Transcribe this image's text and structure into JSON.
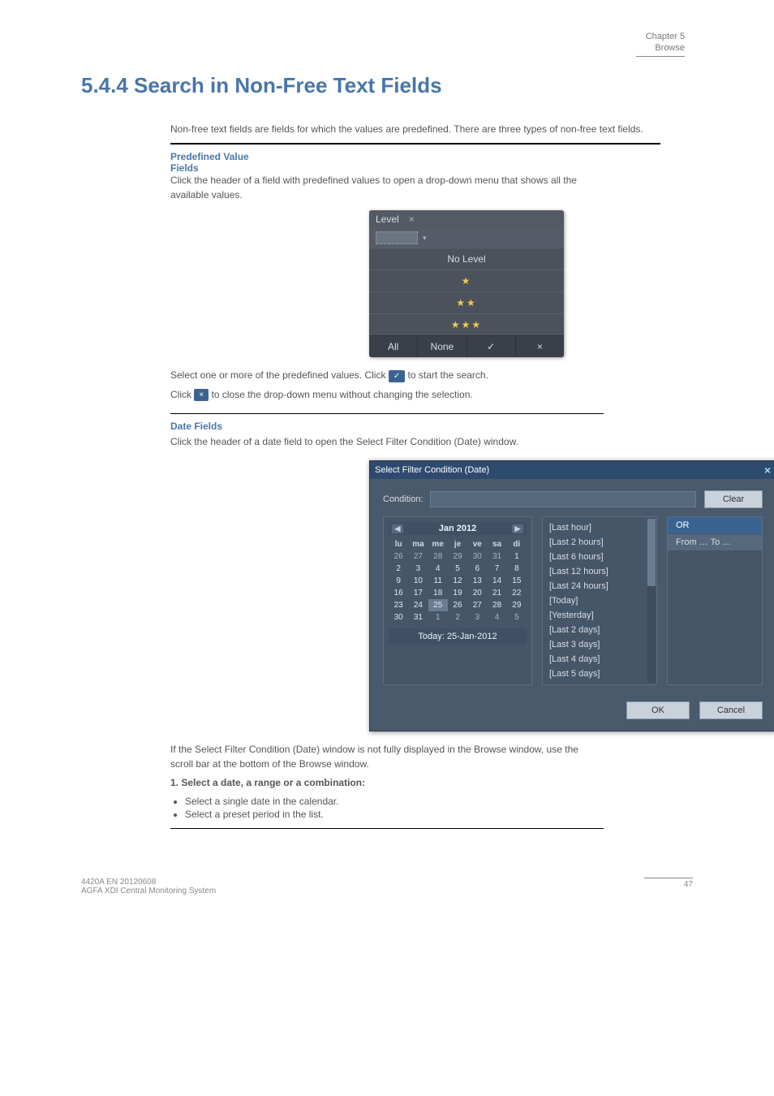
{
  "header": {
    "chapter": "Chapter 5",
    "name": "Browse"
  },
  "heading": "5.4.4  Search  in  Non-Free  Text  Fields",
  "intro": "Non-free text fields are fields for which the values are predefined. There are three types of non-free text fields.",
  "level_block": {
    "title": "Predefined Value Fields",
    "desc": "Click the header of a field with predefined values to open a drop-down menu that shows all the available values.",
    "ui": {
      "header": "Level",
      "close_glyph": "×",
      "dd_glyph": "▾",
      "no_level": "No Level",
      "stars1": "★",
      "stars2": "★★",
      "stars3": "★★★",
      "all": "All",
      "none": "None",
      "ok_glyph": "✓",
      "cancel_glyph": "×"
    },
    "below1_a": "Select one or more of the predefined values. Click ",
    "below1_b": " to start the search.",
    "below2_a": "Click ",
    "below2_b": " to close the drop-down menu without changing the selection."
  },
  "date_block": {
    "title": "Date Fields",
    "desc": "Click the header of a date field to open the Select Filter Condition (Date) window.",
    "ui": {
      "title": "Select Filter Condition (Date)",
      "close_glyph": "×",
      "condition": "Condition:",
      "clear": "Clear",
      "month": "Jan 2012",
      "prev": "◀",
      "next": "▶",
      "dow": [
        "lu",
        "ma",
        "me",
        "je",
        "ve",
        "sa",
        "di"
      ],
      "grid": [
        {
          "cells": [
            "26",
            "27",
            "28",
            "29",
            "30",
            "31",
            "1"
          ],
          "in": [
            6
          ]
        },
        {
          "cells": [
            "2",
            "3",
            "4",
            "5",
            "6",
            "7",
            "8"
          ],
          "in": [
            0,
            1,
            2,
            3,
            4,
            5,
            6
          ]
        },
        {
          "cells": [
            "9",
            "10",
            "11",
            "12",
            "13",
            "14",
            "15"
          ],
          "in": [
            0,
            1,
            2,
            3,
            4,
            5,
            6
          ]
        },
        {
          "cells": [
            "16",
            "17",
            "18",
            "19",
            "20",
            "21",
            "22"
          ],
          "in": [
            0,
            1,
            2,
            3,
            4,
            5,
            6
          ]
        },
        {
          "cells": [
            "23",
            "24",
            "25",
            "26",
            "27",
            "28",
            "29"
          ],
          "in": [
            0,
            1,
            2,
            3,
            4,
            5,
            6
          ],
          "sel": 2
        },
        {
          "cells": [
            "30",
            "31",
            "1",
            "2",
            "3",
            "4",
            "5"
          ],
          "in": [
            0,
            1
          ]
        }
      ],
      "today": "Today: 25-Jan-2012",
      "presets": [
        "[Last hour]",
        "[Last 2 hours]",
        "[Last 6 hours]",
        "[Last 12 hours]",
        "[Last 24 hours]",
        "[Today]",
        "[Yesterday]",
        "[Last 2 days]",
        "[Last 3 days]",
        "[Last 4 days]",
        "[Last 5 days]"
      ],
      "ops": [
        "OR",
        "From … To …"
      ],
      "ok": "OK",
      "cancel": "Cancel"
    },
    "below1": "If the Select Filter Condition (Date) window is not fully displayed in the Browse window, use the scroll bar at the bottom of the Browse window.",
    "step1": "1. Select a date, a range or a combination:",
    "step_items": [
      "Select a single date in the calendar.",
      "Select a preset period in the list."
    ]
  },
  "footer": {
    "doc": "4420A EN 20120608",
    "product": "AGFA XDI Central Monitoring System",
    "page": "47"
  }
}
